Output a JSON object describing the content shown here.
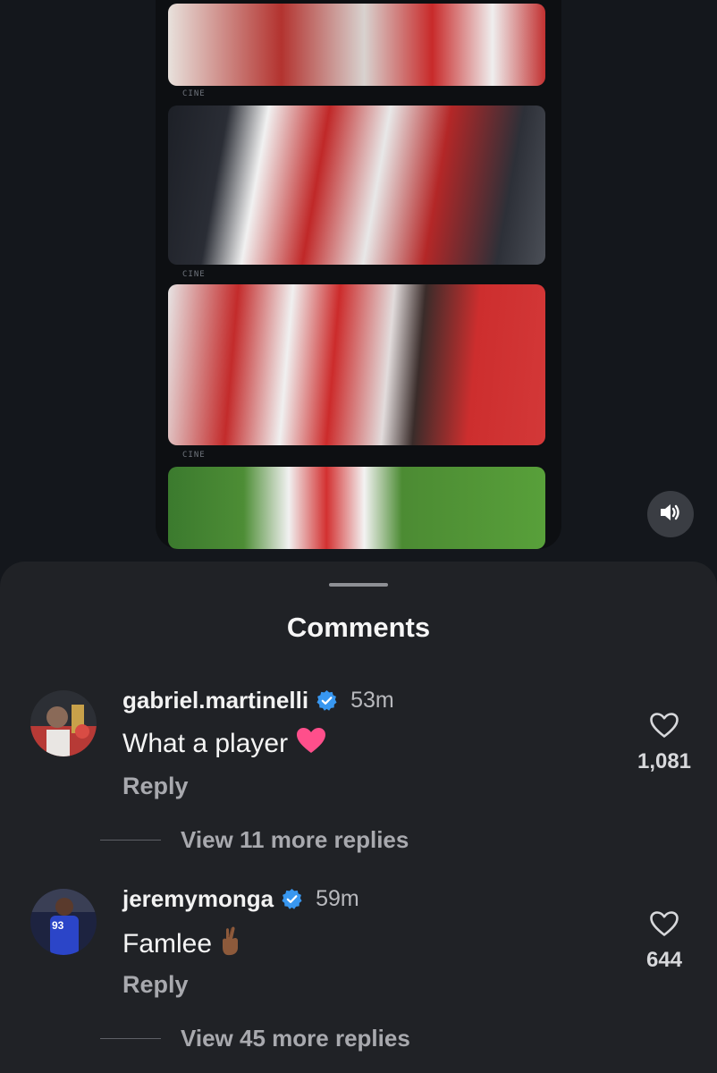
{
  "sheet": {
    "title": "Comments"
  },
  "comments": [
    {
      "username": "gabriel.martinelli",
      "time": "53m",
      "text": "What a player",
      "reply_label": "Reply",
      "likes": "1,081",
      "view_more": "View 11 more replies"
    },
    {
      "username": "jeremymonga",
      "time": "59m",
      "text": "Famlee",
      "reply_label": "Reply",
      "likes": "644",
      "view_more": "View 45 more replies"
    }
  ],
  "video": {
    "overlay_labels": [
      "CINE",
      "CINE",
      "CINE"
    ]
  },
  "colors": {
    "sheet_bg": "#202226",
    "verified_blue": "#3897f0",
    "heart_emoji": "#ff4f8b"
  },
  "icons": [
    "speaker-icon",
    "verified-badge-icon",
    "heart-outline-icon",
    "heart-emoji-icon",
    "crossed-fingers-emoji-icon"
  ]
}
